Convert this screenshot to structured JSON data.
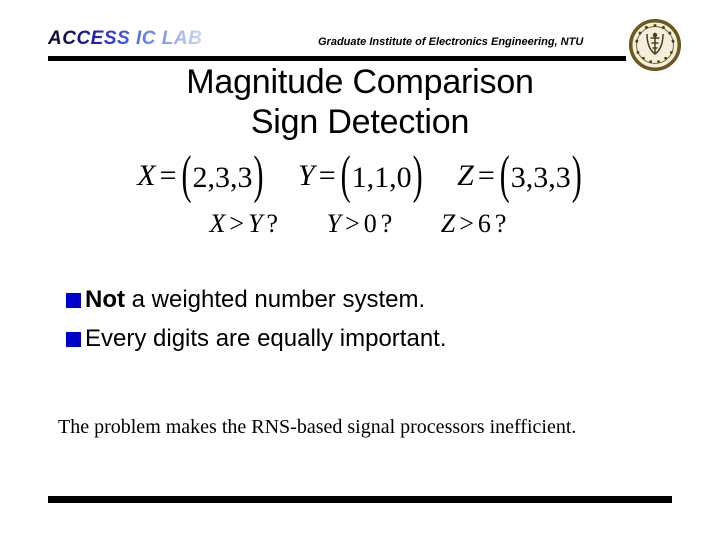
{
  "slide": {
    "background_color": "#ffffff",
    "rule_color": "#000000",
    "bullet_color": "#0000CC"
  },
  "header": {
    "lab_logo": "ACCESS IC LAB",
    "logo_gradient_start": "#0a0a1e",
    "logo_gradient_end": "#ccd6f2",
    "institute": "Graduate Institute of Electronics Engineering, NTU",
    "seal_name": "ntu-seal",
    "seal_ring_color": "#6b5a1e",
    "seal_face_color": "#f2ecd8"
  },
  "title": {
    "line1": "Magnitude Comparison",
    "line2": "Sign Detection"
  },
  "math": {
    "definitions": [
      {
        "var": "X",
        "op": "=",
        "open": "(",
        "values": "2,3,3",
        "close": ")"
      },
      {
        "var": "Y",
        "op": "=",
        "open": "(",
        "values": "1,1,0",
        "close": ")"
      },
      {
        "var": "Z",
        "op": "=",
        "open": "(",
        "values": "3,3,3",
        "close": ")"
      }
    ],
    "queries": [
      {
        "lhs": "X",
        "op": ">",
        "rhs": "Y",
        "mark": "?"
      },
      {
        "lhs": "Y",
        "op": ">",
        "rhs": "0",
        "mark": "?"
      },
      {
        "lhs": "Z",
        "op": ">",
        "rhs": "6",
        "mark": "?"
      }
    ]
  },
  "bullets": [
    {
      "lead": "Not",
      "rest": " a weighted number system."
    },
    {
      "lead": "",
      "rest": "Every digits are equally important."
    }
  ],
  "paragraph": "The problem makes the RNS-based signal processors inefficient."
}
